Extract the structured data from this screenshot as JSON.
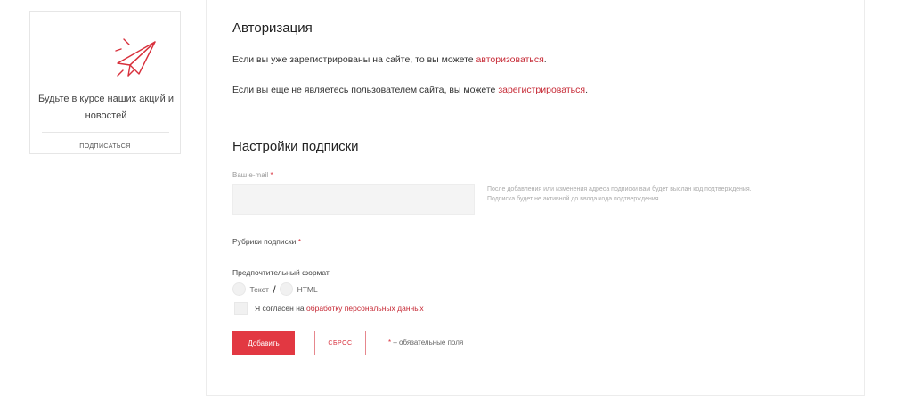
{
  "sidebar": {
    "promo_line1": "Будьте в курсе наших акций и",
    "promo_line2": "новостей",
    "subscribe_link": "подписаться"
  },
  "auth": {
    "title": "Авторизация",
    "line1_prefix": "Если вы уже зарегистрированы на сайте, то вы можете ",
    "line1_link": "авторизоваться",
    "line1_suffix": ".",
    "line2_prefix": "Если вы еще не являетесь пользователем сайта, вы можете ",
    "line2_link": "зарегистрироваться",
    "line2_suffix": "."
  },
  "settings": {
    "title": "Настройки подписки",
    "email_label": "Ваш e-mail",
    "required_mark": "*",
    "email_value": "",
    "hint_line1": "После добавления или изменения адреса подписки вам будет выслан код подтверждения.",
    "hint_line2": "Подписка будет не активной до ввода кода подтверждения.",
    "rubrics_label": "Рубрики подписки",
    "format_label": "Предпочтительный формат",
    "format_text": "Текст",
    "format_sep": "/",
    "format_html": "HTML",
    "consent_prefix": "Я согласен на ",
    "consent_link": "обработку персональных данных",
    "add_button": "Добавить",
    "reset_button": "сброс",
    "required_note": " – обязательные поля"
  },
  "colors": {
    "accent": "#e23842",
    "link": "#c62834"
  },
  "icons": {
    "plane": "paper-plane-icon"
  }
}
